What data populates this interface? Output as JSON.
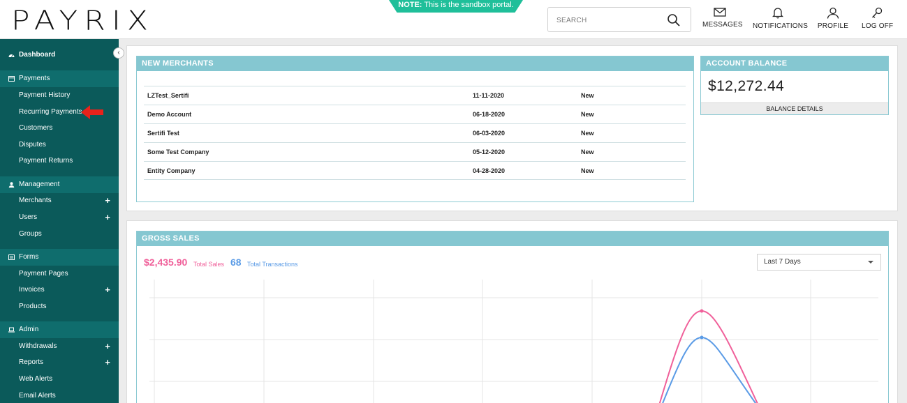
{
  "header": {
    "logo": "PAYRIX",
    "note_bold": "NOTE:",
    "note_text": " This is the sandbox portal.",
    "search_placeholder": "SEARCH",
    "messages": "MESSAGES",
    "notifications": "NOTIFICATIONS",
    "profile": "PROFILE",
    "logoff": "LOG OFF"
  },
  "sidebar": {
    "dashboard": "Dashboard",
    "payments": {
      "label": "Payments",
      "items": [
        "Payment History",
        "Recurring Payments",
        "Customers",
        "Disputes",
        "Payment Returns"
      ]
    },
    "management": {
      "label": "Management",
      "items": [
        "Merchants",
        "Users",
        "Groups"
      ]
    },
    "forms": {
      "label": "Forms",
      "items": [
        "Payment Pages",
        "Invoices",
        "Products"
      ]
    },
    "admin": {
      "label": "Admin",
      "items": [
        "Withdrawals",
        "Reports",
        "Web Alerts",
        "Email Alerts"
      ]
    }
  },
  "new_merchants": {
    "title": "NEW MERCHANTS",
    "rows": [
      {
        "name": "LZTest_Sertifi",
        "date": "11-11-2020",
        "status": "New"
      },
      {
        "name": "Demo Account",
        "date": "06-18-2020",
        "status": "New"
      },
      {
        "name": "Sertifi Test",
        "date": "06-03-2020",
        "status": "New"
      },
      {
        "name": "Some Test Company",
        "date": "05-12-2020",
        "status": "New"
      },
      {
        "name": "Entity Company",
        "date": "04-28-2020",
        "status": "New"
      }
    ]
  },
  "account_balance": {
    "title": "ACCOUNT BALANCE",
    "amount": "$12,272.44",
    "details_button": "BALANCE DETAILS"
  },
  "gross_sales": {
    "title": "GROSS SALES",
    "total_sales": "$2,435.90",
    "total_sales_label": "Total  Sales",
    "total_transactions": "68",
    "total_transactions_label": "Total  Transactions",
    "range_selected": "Last 7 Days"
  },
  "colors": {
    "sidebar_bg": "#0b5a5a",
    "sidebar_section": "#0f6d6d",
    "card_header": "#85c7d1",
    "sales_pink": "#f0609a",
    "transactions_blue": "#5a9be6",
    "note_green": "#1fbf9a"
  }
}
